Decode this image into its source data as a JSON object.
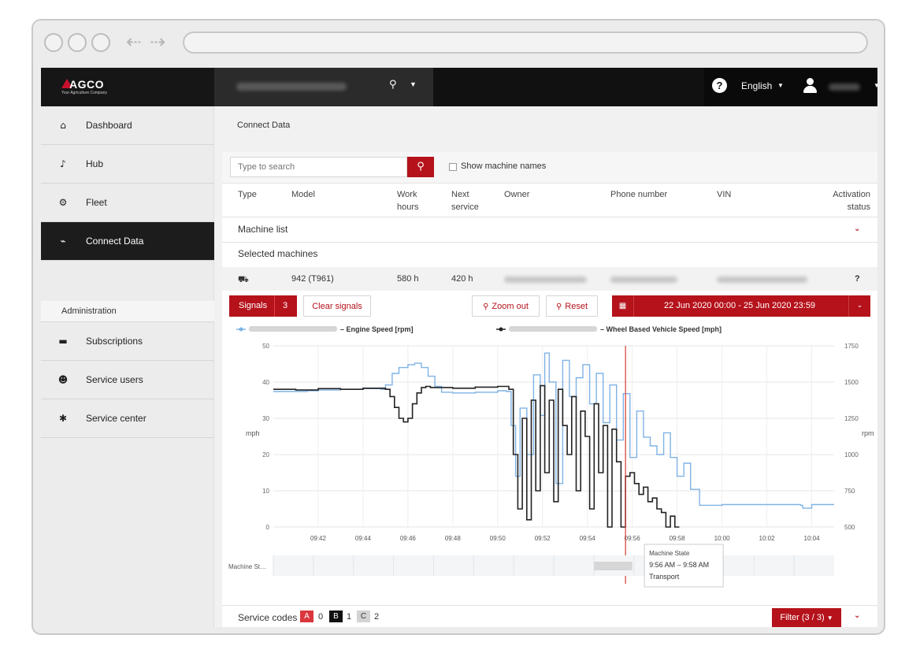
{
  "brand": {
    "name": "AGCO",
    "tagline": "Your Agriculture Company"
  },
  "header": {
    "language": "English"
  },
  "sidebar": {
    "items": [
      {
        "label": "Dashboard",
        "icon": "home-icon"
      },
      {
        "label": "Hub",
        "icon": "bell-icon"
      },
      {
        "label": "Fleet",
        "icon": "tractor-icon"
      },
      {
        "label": "Connect Data",
        "icon": "chart-icon",
        "active": true
      },
      {
        "label": "Subscriptions",
        "icon": "card-icon"
      },
      {
        "label": "Service users",
        "icon": "users-icon"
      },
      {
        "label": "Service center",
        "icon": "gear-icon"
      }
    ],
    "sub": {
      "label": "Administration"
    }
  },
  "main": {
    "breadcrumb": "Connect Data",
    "search": {
      "placeholder": "Type to search",
      "show_names": "Show machine names"
    },
    "columns": {
      "type": "Type",
      "model": "Model",
      "work1": "Work",
      "work2": "hours",
      "next1": "Next",
      "next2": "service",
      "owner": "Owner",
      "phone": "Phone number",
      "vin": "VIN",
      "act1": "Activation",
      "act2": "status"
    },
    "machine_list": "Machine list",
    "selected_machines": "Selected machines",
    "machine": {
      "model": "942 (T961)",
      "work_hours": "580 h",
      "next_service": "420 h",
      "status": "?"
    },
    "toolbar": {
      "signals": "Signals",
      "signals_count": "3",
      "clear": "Clear signals",
      "zoom_out": "Zoom out",
      "reset": "Reset",
      "date_range": "22 Jun 2020 00:00 - 25 Jun 2020 23:59"
    },
    "service": {
      "label": "Service codes",
      "a": "A",
      "a_count": "0",
      "b": "B",
      "b_count": "1",
      "c": "C",
      "c_count": "2",
      "filter": "Filter (3 / 3)"
    }
  },
  "chart_data": {
    "type": "line",
    "legend": [
      {
        "name": "– Engine Speed [rpm]",
        "color": "#7fb2e5"
      },
      {
        "name": "– Wheel Based Vehicle Speed [mph]",
        "color": "#222222"
      }
    ],
    "ylabel_left": "mph",
    "ylabel_right": "rpm",
    "y_left_ticks": [
      "50",
      "40",
      "30",
      "20",
      "10",
      "0"
    ],
    "y_right_ticks": [
      "1750",
      "1500",
      "1250",
      "1000",
      "750",
      "500"
    ],
    "x_ticks": [
      "09:42",
      "09:44",
      "09:46",
      "09:48",
      "09:50",
      "09:52",
      "09:54",
      "09:56",
      "09:58",
      "10:00",
      "10:02",
      "10:04"
    ],
    "x_range_minutes": [
      40.0,
      65.0
    ],
    "y_left_range": [
      0,
      50
    ],
    "y_right_range": [
      500,
      1750
    ],
    "cursor_x": 55.7,
    "series": [
      {
        "name": "Engine Speed [rpm]",
        "axis": "right",
        "color": "#7fb2e5",
        "x": [
          40.0,
          41.5,
          42.0,
          43.0,
          44.0,
          44.8,
          45.0,
          45.3,
          45.6,
          46.0,
          46.3,
          46.6,
          46.9,
          47.2,
          47.5,
          48.0,
          49.0,
          50.0,
          50.4,
          50.6,
          50.8,
          51.0,
          51.3,
          51.6,
          51.9,
          52.1,
          52.3,
          52.6,
          52.9,
          53.2,
          53.5,
          53.8,
          54.1,
          54.4,
          54.7,
          55.0,
          55.3,
          55.6,
          55.9,
          56.2,
          56.5,
          56.8,
          57.1,
          57.4,
          57.7,
          58.0,
          58.3,
          58.6,
          59.0,
          60.0,
          62.0,
          63.5,
          63.6,
          64.0,
          65.0
        ],
        "y": [
          1435,
          1440,
          1445,
          1450,
          1455,
          1450,
          1480,
          1560,
          1600,
          1620,
          1630,
          1600,
          1540,
          1470,
          1430,
          1425,
          1430,
          1440,
          1435,
          1200,
          850,
          1320,
          1000,
          1550,
          1270,
          1700,
          1500,
          800,
          1650,
          1400,
          1530,
          1620,
          1350,
          1560,
          1220,
          1480,
          1100,
          1420,
          980,
          1300,
          1120,
          1060,
          1000,
          1150,
          980,
          850,
          940,
          760,
          650,
          655,
          655,
          650,
          630,
          655,
          655
        ]
      },
      {
        "name": "Wheel Based Vehicle Speed [mph]",
        "axis": "left",
        "color": "#222222",
        "x": [
          40.0,
          41.0,
          42.0,
          43.0,
          44.0,
          45.0,
          45.2,
          45.4,
          45.6,
          45.8,
          46.0,
          46.2,
          46.4,
          46.6,
          46.8,
          47.0,
          48.0,
          49.0,
          50.0,
          50.5,
          50.7,
          50.9,
          51.1,
          51.3,
          51.5,
          51.7,
          51.9,
          52.1,
          52.3,
          52.5,
          52.7,
          52.9,
          53.1,
          53.3,
          53.5,
          53.7,
          53.9,
          54.1,
          54.3,
          54.5,
          54.7,
          54.9,
          55.1,
          55.3,
          55.5,
          55.7,
          55.9,
          56.1,
          56.3,
          56.5,
          56.7,
          56.9,
          57.1,
          57.3,
          57.5,
          57.7,
          57.9,
          58.1
        ],
        "y": [
          38,
          37.8,
          38.2,
          38,
          38.3,
          38,
          36,
          33,
          30,
          29,
          30,
          34,
          37,
          38.5,
          38.8,
          38.5,
          38.3,
          38.6,
          38.8,
          38,
          20,
          5,
          30,
          2,
          35,
          10,
          39,
          15,
          35,
          7,
          38,
          28,
          20,
          36,
          10,
          32,
          25,
          5,
          34,
          15,
          28,
          0,
          27,
          18,
          0,
          14,
          15,
          12,
          9,
          11,
          7,
          8,
          5,
          4,
          0,
          3,
          0,
          0
        ]
      }
    ],
    "timeline": {
      "label": "Machine St…",
      "tooltip_title": "Machine State",
      "tooltip_time": "9:56 AM – 9:58 AM",
      "tooltip_state": "Transport"
    }
  }
}
